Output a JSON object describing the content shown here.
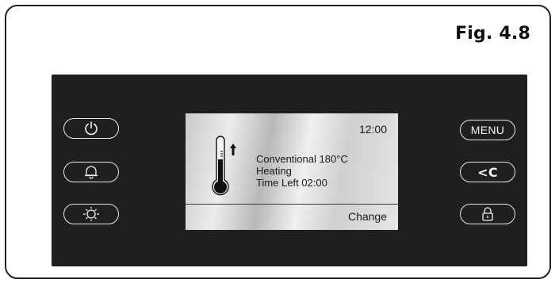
{
  "figure": {
    "label": "Fig. 4.8"
  },
  "left_buttons": [
    {
      "name": "power-button",
      "icon": "power-icon"
    },
    {
      "name": "alarm-button",
      "icon": "bell-icon"
    },
    {
      "name": "light-button",
      "icon": "light-bulb-icon"
    }
  ],
  "right_buttons": {
    "menu_label": "MENU",
    "back_label": "<C",
    "lock_icon": "padlock-icon"
  },
  "display": {
    "clock": "12:00",
    "mode": "Conventional 180°C",
    "status": "Heating",
    "time_left": "Time Left 02:00",
    "action": "Change",
    "icons": [
      "thermometer-icon",
      "up-arrow-icon"
    ]
  },
  "colors": {
    "panel": "#1f1f1f",
    "button_outline": "#e8e8e8",
    "screen": "#d8d8d8"
  }
}
